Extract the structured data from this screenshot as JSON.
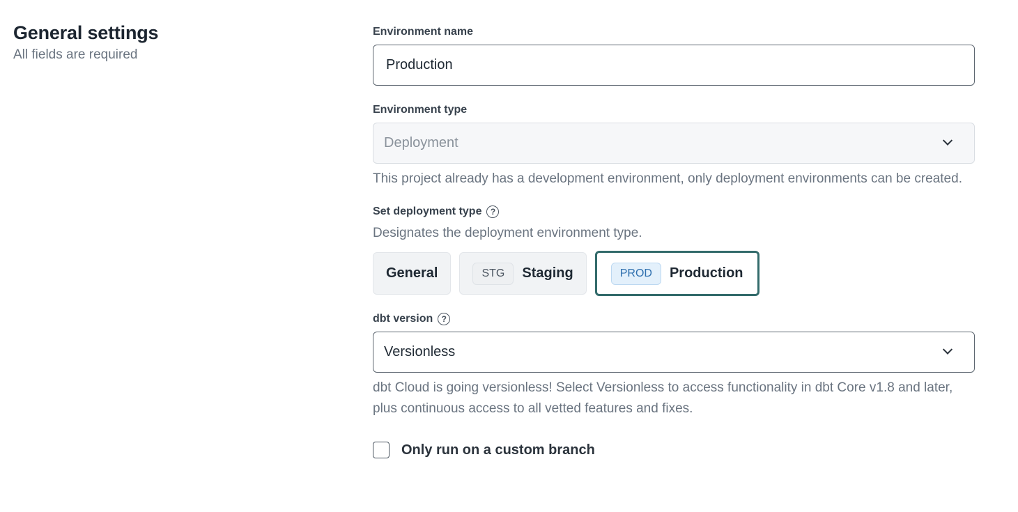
{
  "section": {
    "title": "General settings",
    "subtitle": "All fields are required"
  },
  "environment_name": {
    "label": "Environment name",
    "value": "Production"
  },
  "environment_type": {
    "label": "Environment type",
    "value": "Deployment",
    "hint": "This project already has a development environment, only deployment environments can be created."
  },
  "deployment_type": {
    "label": "Set deployment type",
    "description": "Designates the deployment environment type.",
    "options": [
      {
        "tag": "",
        "label": "General"
      },
      {
        "tag": "STG",
        "label": "Staging"
      },
      {
        "tag": "PROD",
        "label": "Production"
      }
    ],
    "selected": "Production"
  },
  "dbt_version": {
    "label": "dbt version",
    "value": "Versionless",
    "hint": "dbt Cloud is going versionless! Select Versionless to access functionality in dbt Core v1.8 and later, plus continuous access to all vetted features and fixes."
  },
  "custom_branch": {
    "label": "Only run on a custom branch",
    "checked": false
  },
  "icons": {
    "help": "question-circle-icon",
    "chevron": "chevron-down-icon"
  },
  "colors": {
    "selected_border": "#336b6b",
    "prod_tag_bg": "#e3f0fb",
    "prod_tag_text": "#2e6fae"
  }
}
